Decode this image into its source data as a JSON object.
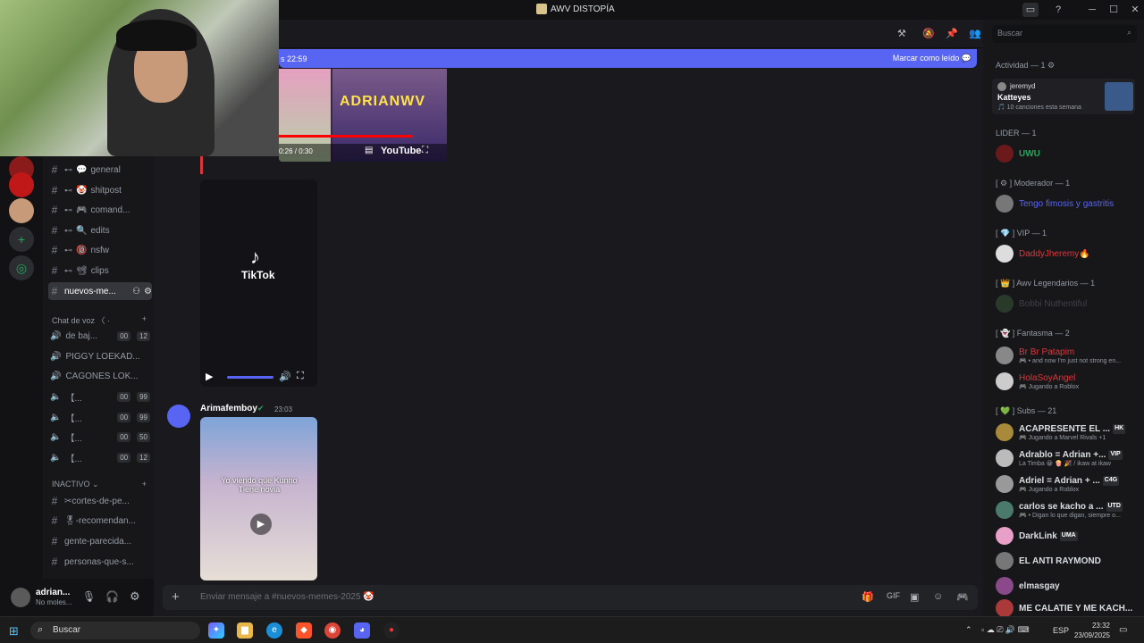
{
  "window": {
    "title": "AWV DISTOPÍA",
    "min": "─",
    "max": "☐",
    "close": "✕"
  },
  "banner": {
    "time_text": "s 22:59",
    "mark_read": "Marcar como leído"
  },
  "channels": [
    {
      "label": "general",
      "icon": "💬"
    },
    {
      "label": "shitpost",
      "icon": "🤡"
    },
    {
      "label": "comand...",
      "icon": "🎮"
    },
    {
      "label": "edits",
      "icon": "🔍"
    },
    {
      "label": "nsfw",
      "icon": "🔞"
    },
    {
      "label": "clips",
      "icon": "📽"
    },
    {
      "label": "nuevos-me...",
      "icon": ""
    }
  ],
  "voice_category": "Chat de voz 〈 ·",
  "voice_channels": [
    {
      "label": "de baj...",
      "b1": "00",
      "b2": "12"
    },
    {
      "label": "PIGGY LOEKAD...",
      "b1": "",
      "b2": ""
    },
    {
      "label": "CAGONES LOK...",
      "b1": "",
      "b2": ""
    },
    {
      "label": "【...",
      "b1": "00",
      "b2": "99"
    },
    {
      "label": "【...",
      "b1": "00",
      "b2": "99"
    },
    {
      "label": "【...",
      "b1": "00",
      "b2": "50"
    },
    {
      "label": "【...",
      "b1": "00",
      "b2": "12"
    }
  ],
  "inactive_category": "INACTIVO ⌄",
  "inactive_channels": [
    "✂cortes-de-pe...",
    "🎖-recomendan...",
    "gente-parecida...",
    "personas-que-s..."
  ],
  "user": {
    "name": "adrian...",
    "status": "No moles..."
  },
  "embed": {
    "timecode": "0:26 / 0:30",
    "brand": "YouTube",
    "overlay": "ADRIANWV"
  },
  "tiktok": {
    "label": "TikTok"
  },
  "message": {
    "author": "Arimafemboy",
    "time": "23:03",
    "caption": "Yo viendo que Kunno Tiene novia"
  },
  "composer": {
    "placeholder": "Enviar mensaje a #nuevos-memes-2025 🤡"
  },
  "search": {
    "placeholder": "Buscar"
  },
  "members": {
    "activity_header": "Actividad — 1 ⚙",
    "activity": {
      "user": "jeremyd",
      "title": "Katteyes",
      "sub": "🎵 10 canciones esta semana"
    },
    "sections": [
      {
        "header": "LIDER — 1",
        "members": [
          {
            "name": "UWU",
            "color": "#23a55a",
            "sub": "",
            "tag": ""
          }
        ]
      },
      {
        "header": "[ ⚙ ] Moderador — 1",
        "members": [
          {
            "name": "Tengo fimosis y gastritis",
            "color": "#5865f2",
            "sub": "",
            "tag": ""
          }
        ]
      },
      {
        "header": "[ 💎 ] VIP — 1",
        "members": [
          {
            "name": "DaddyJheremy🔥",
            "color": "#da373c",
            "sub": "",
            "tag": ""
          }
        ]
      },
      {
        "header": "[ 👑 ] Awv Legendarios — 1",
        "members": [
          {
            "name": "Bobbi Nuthentiful",
            "color": "#3f4147",
            "sub": "",
            "tag": ""
          }
        ]
      },
      {
        "header": "[ 👻 ] Fantasma — 2",
        "members": [
          {
            "name": "Br Br Patapim",
            "color": "#da373c",
            "sub": "🎮 • and now I'm just not strong en...",
            "tag": ""
          },
          {
            "name": "HolaSoyAngel",
            "color": "#da373c",
            "sub": "🎮 Jugando a Roblox",
            "tag": ""
          }
        ]
      },
      {
        "header": "[ 💚 ] Subs — 21",
        "members": [
          {
            "name": "ACÁPRESENTE EL ...",
            "color": "#ffffff",
            "sub": "🎮 Jugando a Marvel Rivals +1",
            "tag": "HK"
          },
          {
            "name": "Adrablo = Adrian +...",
            "color": "#ffffff",
            "sub": "La Timba 😀 🍿 🎉 / ikaw at ikaw",
            "tag": "VIP"
          },
          {
            "name": "Adriel = Adrian + ...",
            "color": "#ffffff",
            "sub": "🎮 Jugando a Roblox",
            "tag": "C4G"
          },
          {
            "name": "carlos se kacho a ...",
            "color": "#ffffff",
            "sub": "🎮 • Digan lo que digan, siempre o...",
            "tag": "UTD"
          },
          {
            "name": "DarkLink",
            "color": "#ffffff",
            "sub": "",
            "tag": "UMA"
          },
          {
            "name": "EL ANTI RAYMOND",
            "color": "#ffffff",
            "sub": "",
            "tag": ""
          },
          {
            "name": "elmasgay",
            "color": "#ffffff",
            "sub": "",
            "tag": ""
          },
          {
            "name": "ME CALATIE Y ME KACH...",
            "color": "#ffffff",
            "sub": "",
            "tag": ""
          }
        ]
      }
    ]
  },
  "taskbar": {
    "search": "Buscar",
    "lang": "ESP",
    "time": "23:32",
    "date": "23/09/2025"
  },
  "colors": {
    "accent": "#5865f2",
    "bg": "#1a1a1e",
    "sidebar": "#17171a",
    "online": "#23a55a"
  }
}
